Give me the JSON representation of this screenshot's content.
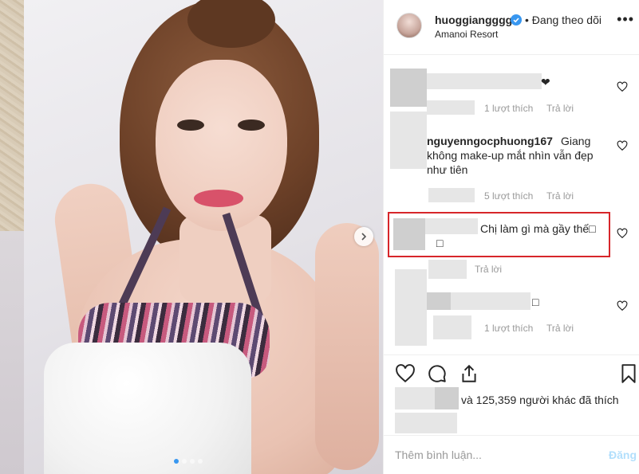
{
  "header": {
    "username": "huoggiangggg",
    "follow_status": "• Đang theo dõi",
    "location": "Amanoi Resort",
    "more_glyph": "•••"
  },
  "comments": [
    {
      "text": "❤",
      "likes": "1 lượt thích",
      "reply": "Trả lời"
    },
    {
      "username": "nguyenngocphuong167",
      "text_line1": "Giang",
      "text_line2": "không make-up mắt nhìn vẫn đẹp",
      "text_line3": "như tiên",
      "likes": "5 lượt thích",
      "reply": "Trả lời"
    },
    {
      "text_line1": "Chị làm gì mà gầy thế□",
      "text_line2": "□",
      "reply": "Trả lời"
    },
    {
      "text": "□",
      "likes": "1 lượt thích",
      "reply": "Trả lời"
    }
  ],
  "likes_text": "và 125,359 người khác đã thích",
  "add_comment": {
    "placeholder": "Thêm bình luận...",
    "post_label": "Đăng"
  },
  "colors": {
    "accent": "#3897f0",
    "highlight_box": "#d7262a"
  },
  "icons": [
    "heart-icon",
    "comment-icon",
    "share-icon",
    "bookmark-icon",
    "verified-icon",
    "chevron-right-icon"
  ]
}
